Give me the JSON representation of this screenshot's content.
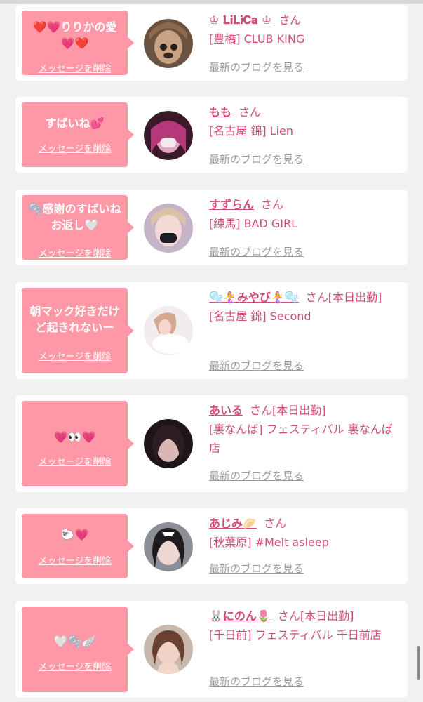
{
  "colors": {
    "accent": "#d24b77",
    "bubble": "#fe98a6",
    "background": "#f2f0f1"
  },
  "items": [
    {
      "message": "❤️💗りりかの愛\n💗❤️",
      "delete_label": "メッセージを削除",
      "name": "♔ 𝐋𝐢𝐋𝐢𝐂𝐚 ♔",
      "san": "さん",
      "shop": "[豊橋] CLUB KING",
      "blog_label": "最新のブログを見る"
    },
    {
      "message": "すばいね💕",
      "delete_label": "メッセージを削除",
      "name": "もも",
      "san": "さん",
      "shop": "[名古屋 錦] Lien",
      "blog_label": "最新のブログを見る"
    },
    {
      "message": "🫧感謝のすばいね\nお返し🤍",
      "delete_label": "メッセージを削除",
      "name": "すずらん",
      "san": "さん",
      "shop": "[練馬] BAD GIRL",
      "blog_label": "最新のブログを見る"
    },
    {
      "message": "朝マック好きだけ\nど起きれないー",
      "delete_label": "メッセージを削除",
      "name": "🫧🧜‍♀️みやび🧜‍♀️🫧",
      "san": "さん[本日出勤]",
      "shop": "[名古屋 錦] Second",
      "blog_label": "最新のブログを見る"
    },
    {
      "message": "💗👀💗",
      "delete_label": "メッセージを削除",
      "name": "あいる",
      "san": "さん[本日出勤]",
      "shop": "[裏なんば] フェスティバル 裏なんば店",
      "blog_label": "最新のブログを見る"
    },
    {
      "message": "🐑💗",
      "delete_label": "メッセージを削除",
      "name": "あじみ🥟",
      "san": "さん",
      "shop": "[秋葉原] #Melt asleep",
      "blog_label": "最新のブログを見る"
    },
    {
      "message": "🤍🫧🪽",
      "delete_label": "メッセージを削除",
      "name": "🐰にのん🌷",
      "san": "さん[本日出勤]",
      "shop": "[千日前] フェスティバル 千日前店",
      "blog_label": "最新のブログを見る"
    }
  ]
}
